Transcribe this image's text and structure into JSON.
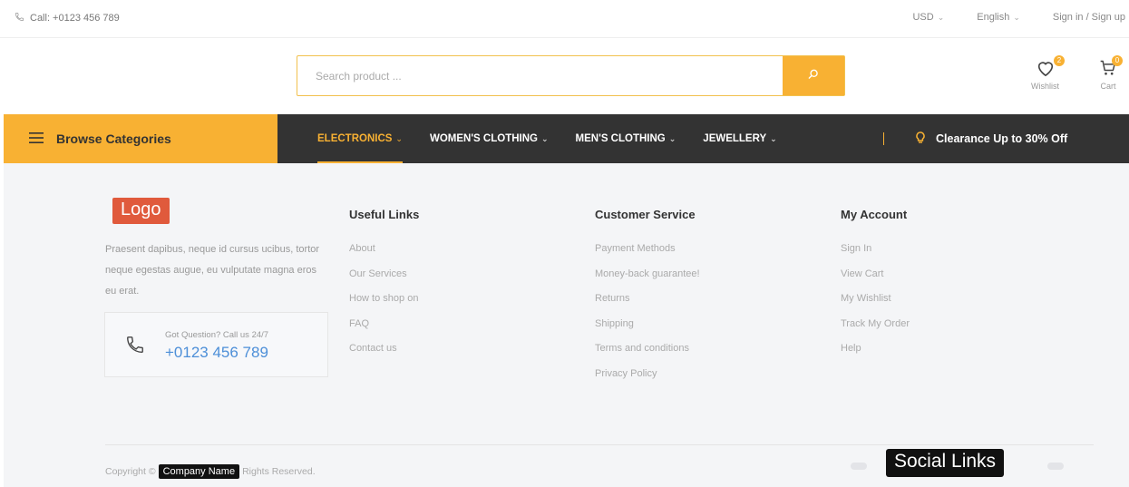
{
  "topbar": {
    "call_text": "Call: +0123 456 789",
    "currency": "USD",
    "language": "English",
    "auth": "Sign in / Sign up"
  },
  "header": {
    "search_placeholder": "Search product ...",
    "wishlist_label": "Wishlist",
    "wishlist_count": "2",
    "cart_label": "Cart",
    "cart_count": "0"
  },
  "nav": {
    "browse_label": "Browse Categories",
    "items": [
      {
        "label": "ELECTRONICS"
      },
      {
        "label": "WOMEN'S CLOTHING"
      },
      {
        "label": "MEN'S CLOTHING"
      },
      {
        "label": "JEWELLERY"
      }
    ],
    "clearance": "Clearance Up to 30% Off"
  },
  "footer": {
    "logo": "Logo",
    "about": "Praesent dapibus, neque id cursus ucibus, tortor neque egestas augue, eu vulputate magna eros eu erat.",
    "call_question": "Got Question? Call us 24/7",
    "call_number": "+0123 456 789",
    "columns": [
      {
        "title": "Useful Links",
        "links": [
          "About",
          "Our Services",
          "How to shop on",
          "FAQ",
          "Contact us"
        ]
      },
      {
        "title": "Customer Service",
        "links": [
          "Payment Methods",
          "Money-back guarantee!",
          "Returns",
          "Shipping",
          "Terms and conditions",
          "Privacy Policy"
        ]
      },
      {
        "title": "My Account",
        "links": [
          "Sign In",
          "View Cart",
          "My Wishlist",
          "Track My Order",
          "Help"
        ]
      }
    ],
    "copyright_prefix": "Copyright ©",
    "company_name": "Company Name",
    "copyright_suffix": "Rights Reserved.",
    "social_label": "Social Links"
  },
  "colors": {
    "accent": "#f8b133",
    "nav_bg": "#333333",
    "footer_bg": "#f4f5f7",
    "logo_bg": "#e05a3c",
    "phone_blue": "#4d8fd8"
  }
}
